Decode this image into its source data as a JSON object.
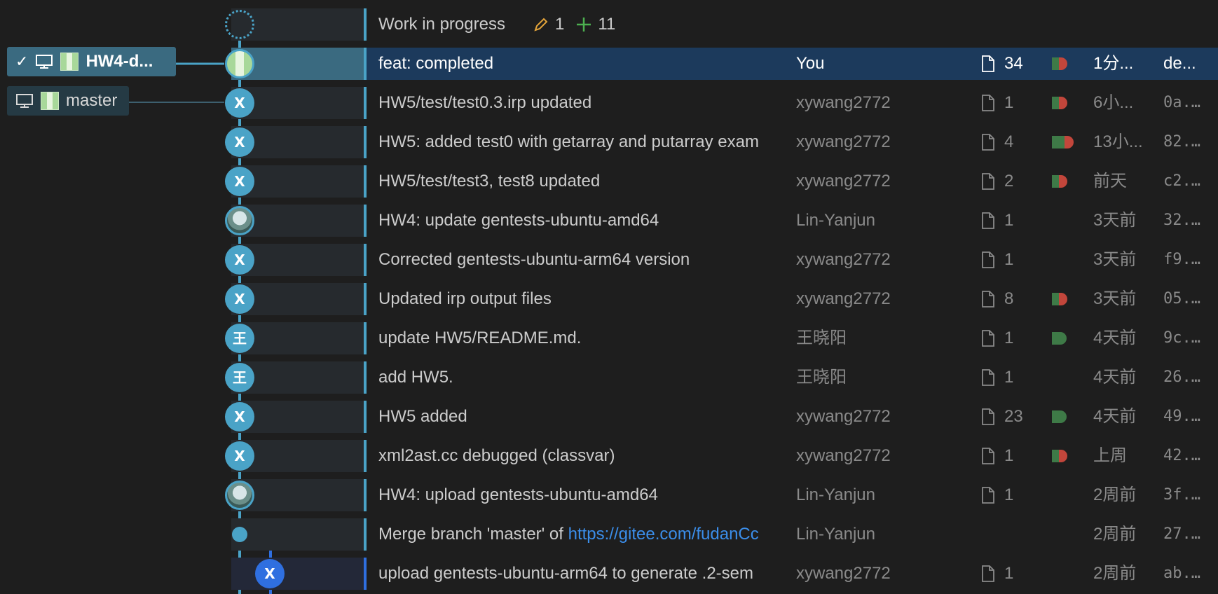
{
  "branches": {
    "current": {
      "label": "HW4-d...",
      "check": "✓"
    },
    "other": {
      "label": "master"
    }
  },
  "wip": {
    "label": "Work in progress",
    "modified_count": "1",
    "added_count": "11",
    "modified_icon": "pencil-icon",
    "added_icon": "plus-icon"
  },
  "colors": {
    "lane_main": "#4aa3c7",
    "lane_blue": "#2f6fe0",
    "selected_row": "#1c3a5c",
    "diff_add": "#3e7a47",
    "diff_del": "#c2463b",
    "link": "#3b8eea"
  },
  "commits": [
    {
      "message": "feat: completed",
      "author": "You",
      "files": "34",
      "date": "1分...",
      "sha": "de...",
      "node": "X",
      "diff": "both",
      "selected": true
    },
    {
      "message": "HW5/test/test0.3.irp updated",
      "author": "xywang2772",
      "files": "1",
      "date": "6小...",
      "sha": "0a...",
      "node": "X",
      "diff": "both"
    },
    {
      "message": "HW5: added test0 with getarray and putarray exam",
      "author": "xywang2772",
      "files": "4",
      "date": "13小...",
      "sha": "82...",
      "node": "X",
      "diff": "both-wide"
    },
    {
      "message": "HW5/test/test3, test8 updated",
      "author": "xywang2772",
      "files": "2",
      "date": "前天",
      "sha": "c2...",
      "node": "X",
      "diff": "both"
    },
    {
      "message": "HW4: update gentests-ubuntu-amd64",
      "author": "Lin-Yanjun",
      "files": "1",
      "date": "3天前",
      "sha": "32...",
      "node": "photo",
      "diff": "none"
    },
    {
      "message": "Corrected gentests-ubuntu-arm64 version",
      "author": "xywang2772",
      "files": "1",
      "date": "3天前",
      "sha": "f9...",
      "node": "X",
      "diff": "none"
    },
    {
      "message": "Updated irp output files",
      "author": "xywang2772",
      "files": "8",
      "date": "3天前",
      "sha": "05...",
      "node": "X",
      "diff": "both"
    },
    {
      "message": "update HW5/README.md.",
      "author": "王晓阳",
      "files": "1",
      "date": "4天前",
      "sha": "9c...",
      "node": "王",
      "diff": "add"
    },
    {
      "message": "add HW5.",
      "author": "王晓阳",
      "files": "1",
      "date": "4天前",
      "sha": "26...",
      "node": "王",
      "diff": "none"
    },
    {
      "message": "HW5 added",
      "author": "xywang2772",
      "files": "23",
      "date": "4天前",
      "sha": "49...",
      "node": "X",
      "diff": "add"
    },
    {
      "message": "xml2ast.cc debugged (classvar)",
      "author": "xywang2772",
      "files": "1",
      "date": "上周",
      "sha": "42...",
      "node": "X",
      "diff": "both"
    },
    {
      "message": "HW4: upload gentests-ubuntu-amd64",
      "author": "Lin-Yanjun",
      "files": "1",
      "date": "2周前",
      "sha": "3f...",
      "node": "photo",
      "diff": "none"
    },
    {
      "message": "Merge branch 'master' of ",
      "link": "https://gitee.com/fudanCc",
      "author": "Lin-Yanjun",
      "files": "",
      "date": "2周前",
      "sha": "27...",
      "node": "merge",
      "diff": "none"
    },
    {
      "message": "upload gentests-ubuntu-arm64 to generate .2-sem",
      "author": "xywang2772",
      "files": "1",
      "date": "2周前",
      "sha": "ab...",
      "node": "X",
      "diff": "none",
      "lane": "blue"
    }
  ]
}
